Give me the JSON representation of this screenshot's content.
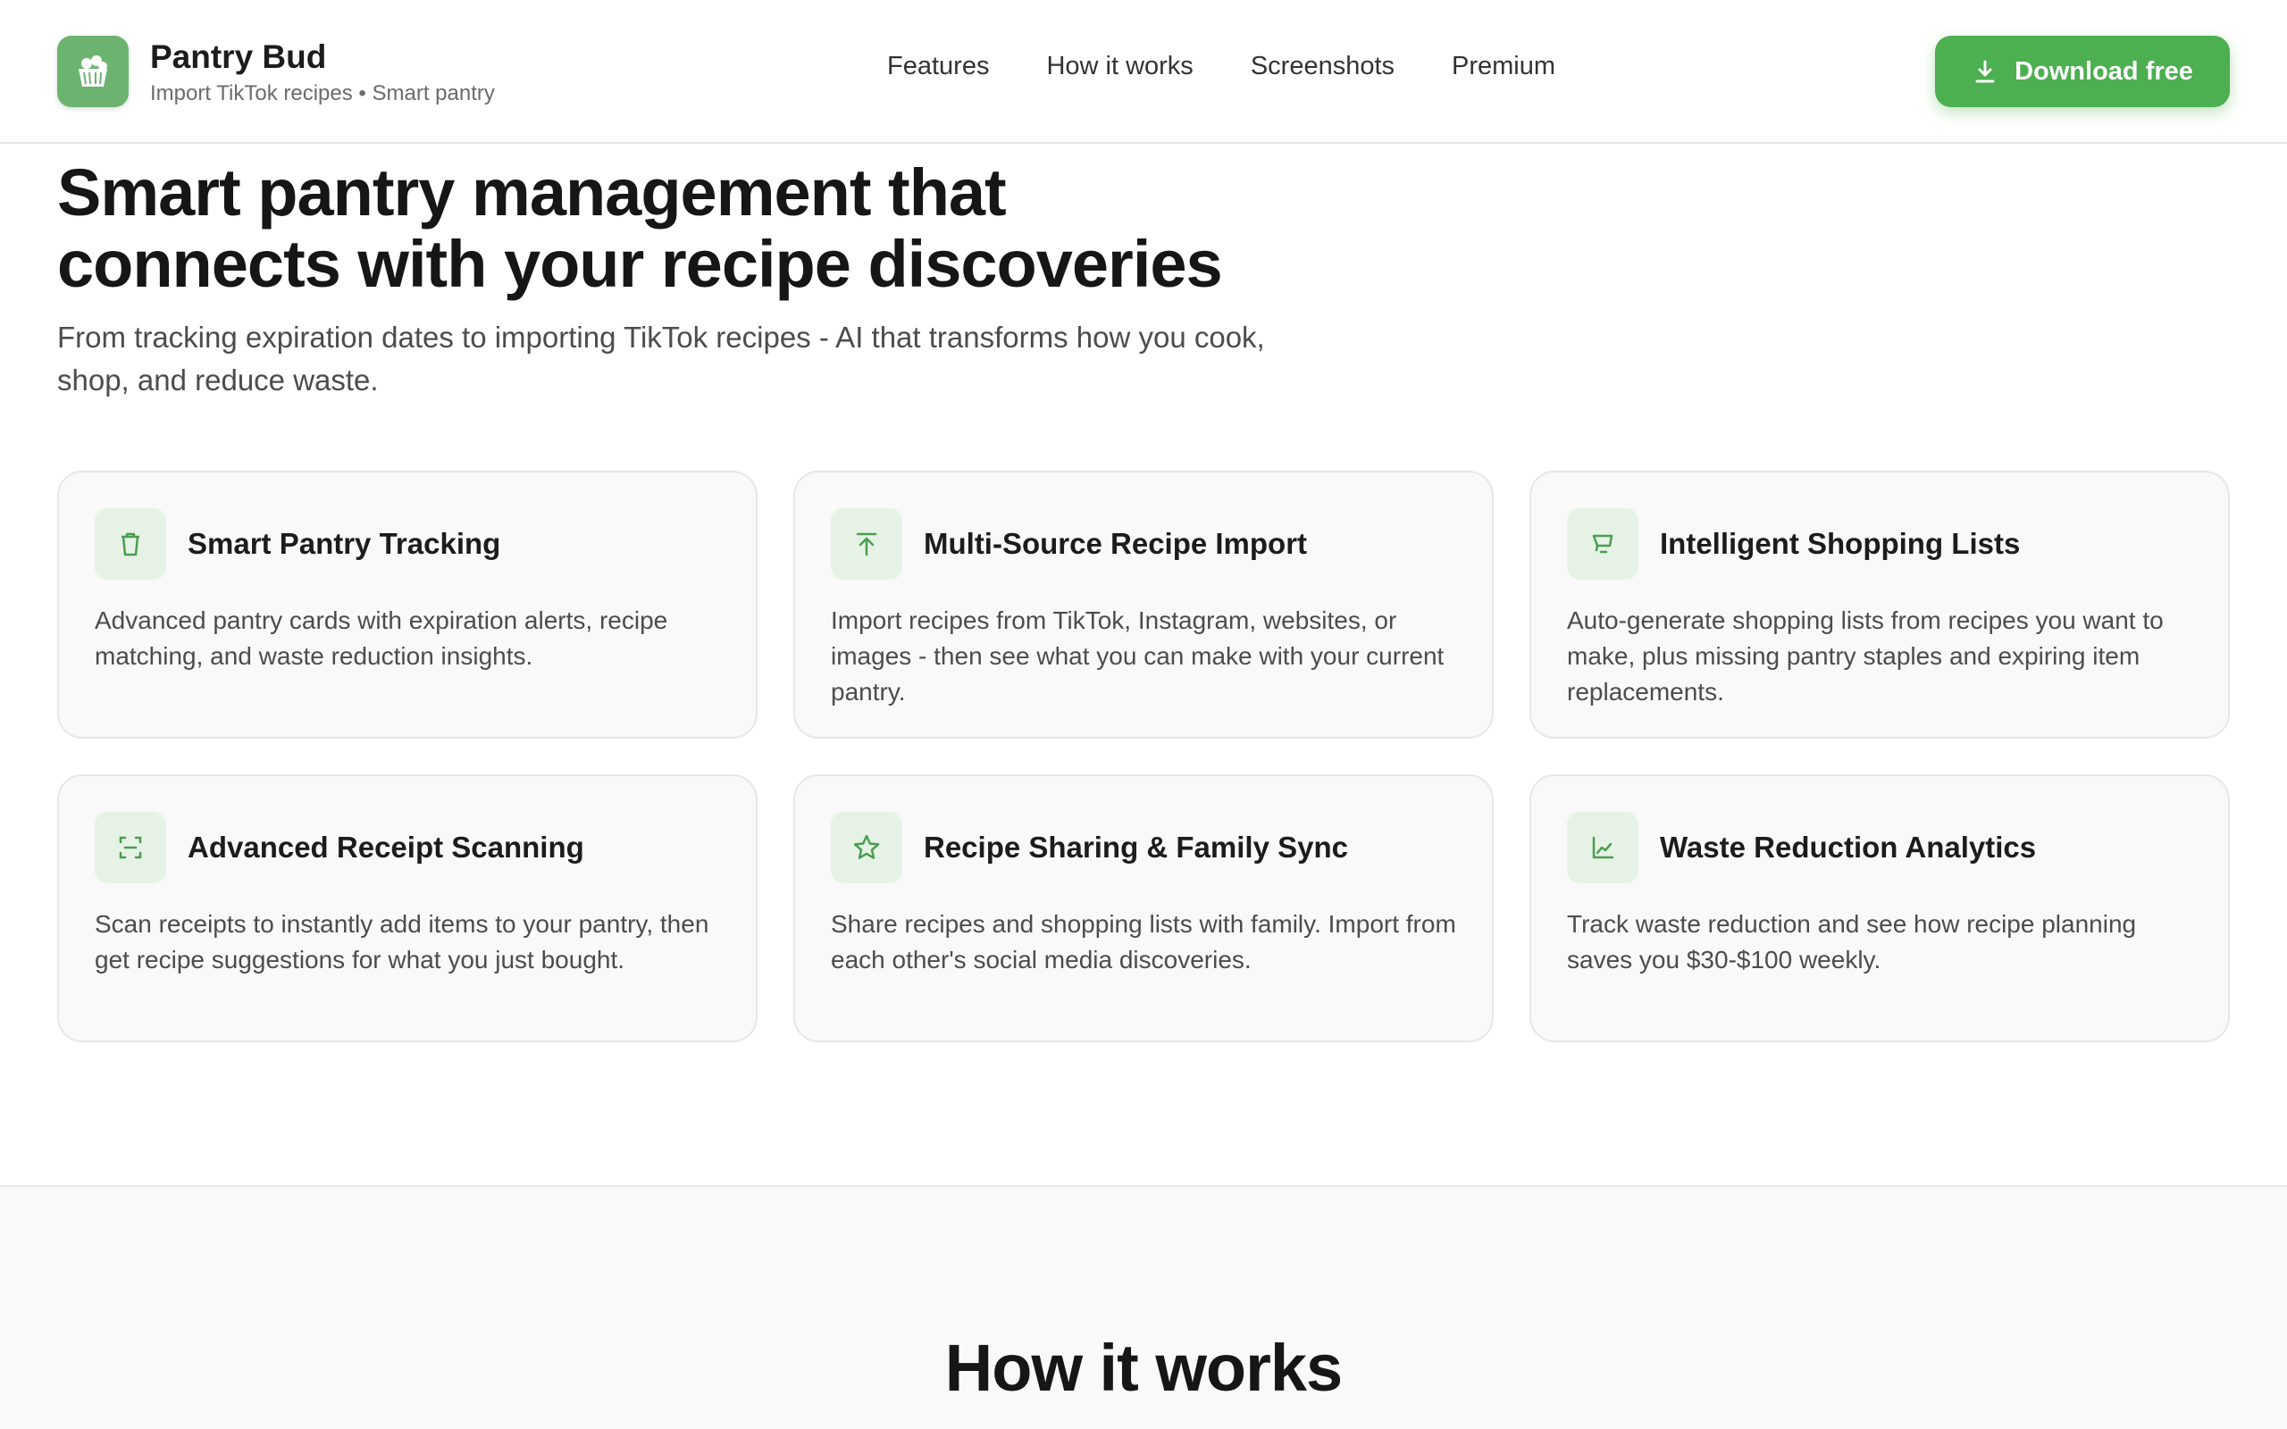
{
  "header": {
    "brand_name": "Pantry Bud",
    "brand_tagline": "Import TikTok recipes • Smart pantry",
    "nav": [
      "Features",
      "How it works",
      "Screenshots",
      "Premium"
    ],
    "download_label": "Download free"
  },
  "hero": {
    "title": "Smart pantry management that connects with your recipe discoveries",
    "subtitle": "From tracking expiration dates to importing TikTok recipes - AI that transforms how you cook, shop, and reduce waste."
  },
  "features": [
    {
      "icon": "trash-can-icon",
      "title": "Smart Pantry Tracking",
      "desc": "Advanced pantry cards with expiration alerts, recipe matching, and waste reduction insights."
    },
    {
      "icon": "upload-arrow-icon",
      "title": "Multi-Source Recipe Import",
      "desc": "Import recipes from TikTok, Instagram, websites, or images - then see what you can make with your current pantry."
    },
    {
      "icon": "cart-icon",
      "title": "Intelligent Shopping Lists",
      "desc": "Auto-generate shopping lists from recipes you want to make, plus missing pantry staples and expiring item replacements."
    },
    {
      "icon": "scan-frame-icon",
      "title": "Advanced Receipt Scanning",
      "desc": "Scan receipts to instantly add items to your pantry, then get recipe suggestions for what you just bought."
    },
    {
      "icon": "star-icon",
      "title": "Recipe Sharing & Family Sync",
      "desc": "Share recipes and shopping lists with family. Import from each other's social media discoveries."
    },
    {
      "icon": "chart-icon",
      "title": "Waste Reduction Analytics",
      "desc": "Track waste reduction and see how recipe planning saves you $30-$100 weekly."
    }
  ],
  "how_it_works": {
    "title": "How it works"
  },
  "colors": {
    "accent": "#4caf50",
    "icon_bg": "#e6f2e6",
    "icon_stroke": "#4a9e4e"
  }
}
